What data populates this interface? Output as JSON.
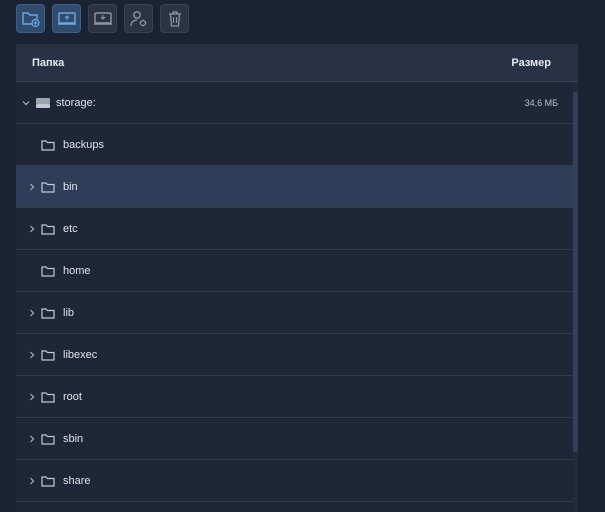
{
  "table": {
    "columns": {
      "folder": "Папка",
      "size": "Размер"
    },
    "root": {
      "name": "storage:",
      "size": "34,6 МБ"
    },
    "items": [
      {
        "name": "backups",
        "expandable": false
      },
      {
        "name": "bin",
        "expandable": true,
        "selected": true
      },
      {
        "name": "etc",
        "expandable": true
      },
      {
        "name": "home",
        "expandable": false
      },
      {
        "name": "lib",
        "expandable": true
      },
      {
        "name": "libexec",
        "expandable": true
      },
      {
        "name": "root",
        "expandable": true
      },
      {
        "name": "sbin",
        "expandable": true
      },
      {
        "name": "share",
        "expandable": true
      }
    ]
  },
  "toolbar": {
    "buttons": [
      "new-folder",
      "upload",
      "download",
      "permissions",
      "delete"
    ]
  },
  "colors": {
    "background": "#1b2333",
    "panel": "#1e2637",
    "header": "#283244",
    "selected_row": "#2f3e58",
    "accent": "#2f4c6e"
  }
}
